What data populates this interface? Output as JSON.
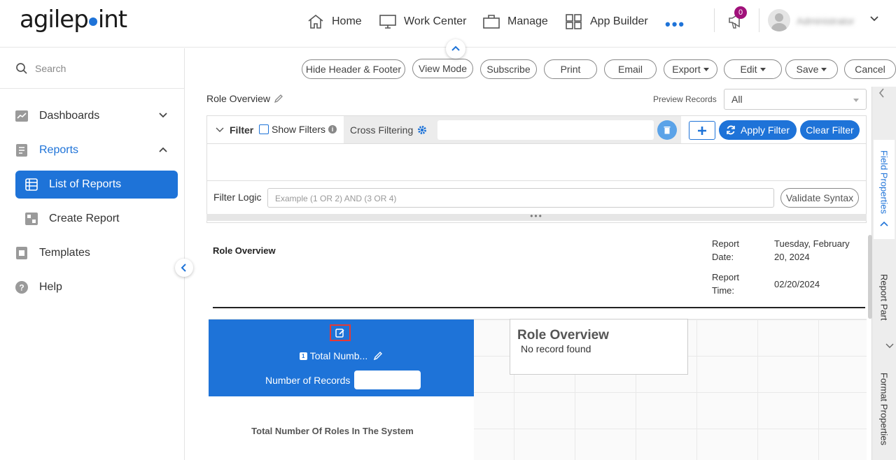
{
  "brand": {
    "logo_text_left": "agilep",
    "logo_text_right": "int"
  },
  "topnav": {
    "items": [
      {
        "label": "Home",
        "icon": "home-icon"
      },
      {
        "label": "Work Center",
        "icon": "monitor-icon"
      },
      {
        "label": "Manage",
        "icon": "briefcase-icon"
      },
      {
        "label": "App Builder",
        "icon": "grid-icon"
      }
    ],
    "more": "•••",
    "notification_count": "0",
    "user_name": "Administrator"
  },
  "sidebar": {
    "search_placeholder": "Search",
    "items": [
      {
        "label": "Dashboards",
        "icon": "chart-icon"
      },
      {
        "label": "Reports",
        "icon": "report-icon"
      },
      {
        "label": "List of Reports",
        "icon": "list-icon"
      },
      {
        "label": "Create Report",
        "icon": "create-icon"
      },
      {
        "label": "Templates",
        "icon": "template-icon"
      },
      {
        "label": "Help",
        "icon": "help-icon"
      }
    ]
  },
  "toolbar": {
    "hide_header": "Hide Header & Footer",
    "view_mode": "View Mode",
    "subscribe": "Subscribe",
    "print": "Print",
    "email": "Email",
    "export": "Export",
    "edit": "Edit",
    "save": "Save",
    "cancel": "Cancel"
  },
  "report": {
    "title": "Role Overview",
    "preview_label": "Preview Records",
    "preview_value": "All"
  },
  "filter": {
    "label": "Filter",
    "show_filters": "Show Filters",
    "cross_filtering": "Cross Filtering",
    "apply": "Apply Filter",
    "clear": "Clear Filter",
    "logic_label": "Filter Logic",
    "logic_placeholder": "Example (1 OR 2) AND (3 OR 4)",
    "validate": "Validate Syntax"
  },
  "report_header": {
    "title": "Role Overview",
    "date_label_1": "Report",
    "date_label_2": "Date:",
    "date_value_1": "Tuesday, February",
    "date_value_2": "20, 2024",
    "time_label_1": "Report",
    "time_label_2": "Time:",
    "time_value": "02/20/2024"
  },
  "panel": {
    "total_label": "Total Numb...",
    "records_label": "Number of Records",
    "description": "Total Number Of Roles In The System"
  },
  "card": {
    "title": "Role Overview",
    "subtitle": "No record found"
  },
  "rail": {
    "field_properties": "Field Properties",
    "report_part": "Report Part",
    "format_properties": "Format Properties"
  },
  "colors": {
    "accent": "#1e73d8",
    "badge": "#a0117a"
  }
}
